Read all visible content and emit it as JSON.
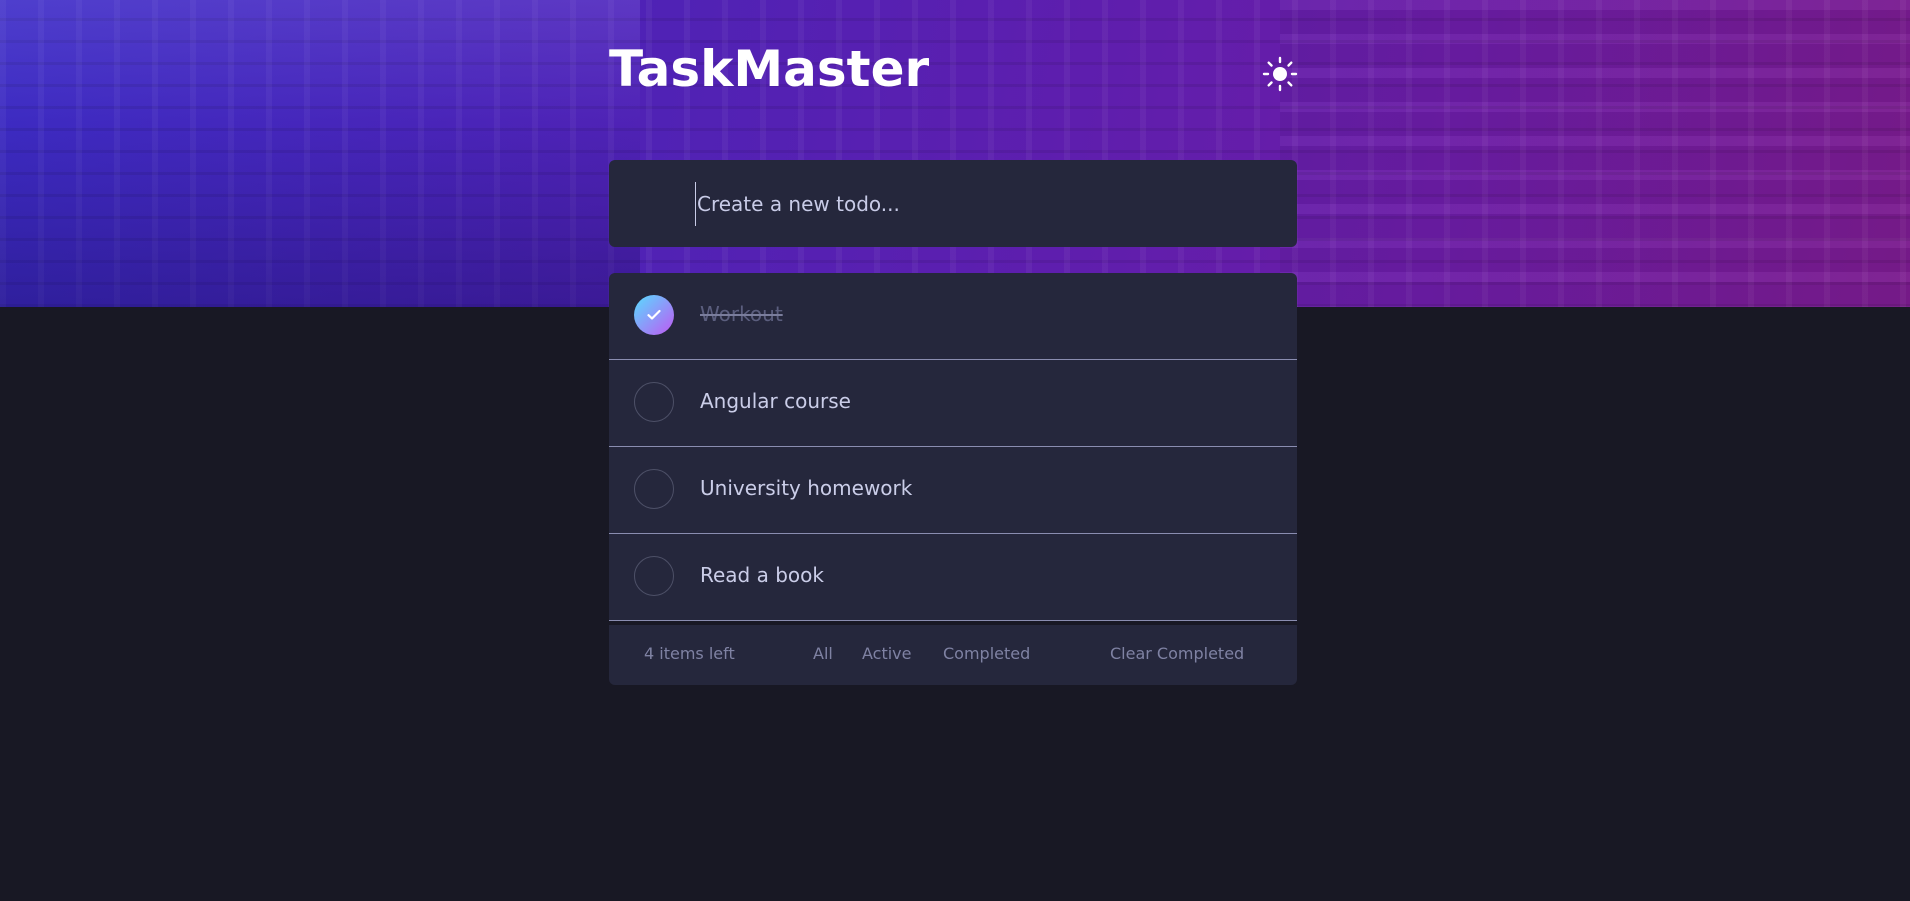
{
  "app": {
    "title": "TaskMaster",
    "theme_icon": "sun-icon"
  },
  "new_todo": {
    "placeholder": "Create a new todo..."
  },
  "todos": [
    {
      "text": "Workout",
      "completed": true
    },
    {
      "text": "Angular course",
      "completed": false
    },
    {
      "text": "University homework",
      "completed": false
    },
    {
      "text": "Read a book",
      "completed": false
    }
  ],
  "footer": {
    "items_left": "4 items left",
    "filters": [
      "All",
      "Active",
      "Completed"
    ],
    "clear_label": "Clear Completed"
  },
  "colors": {
    "background": "#181824",
    "card": "#25273c",
    "text": "#cacde8",
    "muted": "#7f82a3",
    "check_gradient_start": "#57ddff",
    "check_gradient_end": "#c058f3",
    "hero_left": "#3c2bc2",
    "hero_right": "#7b1b8e"
  }
}
